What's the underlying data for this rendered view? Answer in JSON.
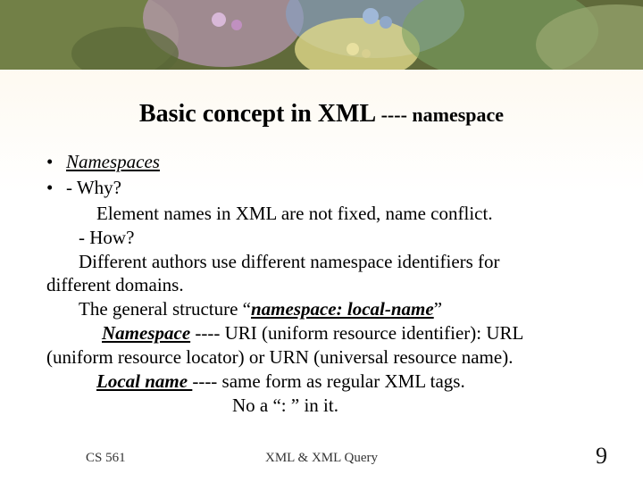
{
  "title": {
    "main": "Basic concept in XML ",
    "sub": "---- namespace"
  },
  "body": {
    "l1": "Namespaces",
    "l2": "-  Why?",
    "l3": "Element names in XML are not fixed, name conflict.",
    "l4": "-  How?",
    "l5": "Different authors use different namespace identifiers for",
    "l6": "different domains.",
    "l7a": "The general structure “",
    "l7b": "namespace: local-name",
    "l7c": "”",
    "l8a": "Namespace",
    "l8b": " ---- URI (uniform resource identifier):  URL",
    "l9": "(uniform resource locator) or URN (universal resource name).",
    "l10a": "Local name ",
    "l10b": " ---- same form as regular XML tags.",
    "l11": "No a “: ” in it."
  },
  "footer": {
    "left": "CS 561",
    "center": "XML & XML Query",
    "page": "9"
  }
}
